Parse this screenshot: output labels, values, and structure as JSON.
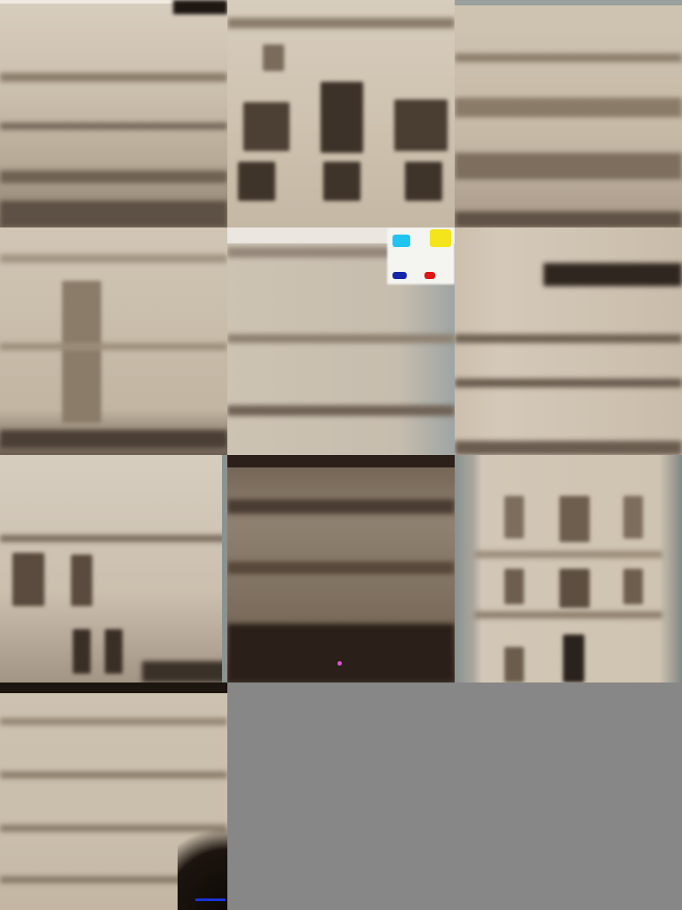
{
  "grid": {
    "columns": 3,
    "rows": 4,
    "background": "#878787",
    "tiles": [
      {
        "subject": "building-facade",
        "tone": "sepia"
      },
      {
        "subject": "building-facade",
        "tone": "sepia"
      },
      {
        "subject": "building-facade",
        "tone": "sepia"
      },
      {
        "subject": "building-facade",
        "tone": "sepia"
      },
      {
        "subject": "building-facade",
        "tone": "sepia",
        "artifact_colors": [
          "#00c8ff",
          "#f5e600",
          "#e01010",
          "#1020b0"
        ]
      },
      {
        "subject": "building-facade",
        "tone": "sepia"
      },
      {
        "subject": "building-facade",
        "tone": "sepia"
      },
      {
        "subject": "building-facade",
        "tone": "dark-sepia"
      },
      {
        "subject": "building-facade",
        "tone": "sepia"
      },
      {
        "subject": "building-facade",
        "tone": "sepia",
        "artifact_colors": [
          "#1a33d8"
        ]
      },
      {
        "subject": "empty",
        "tone": "gray"
      },
      {
        "subject": "empty",
        "tone": "gray"
      }
    ]
  }
}
